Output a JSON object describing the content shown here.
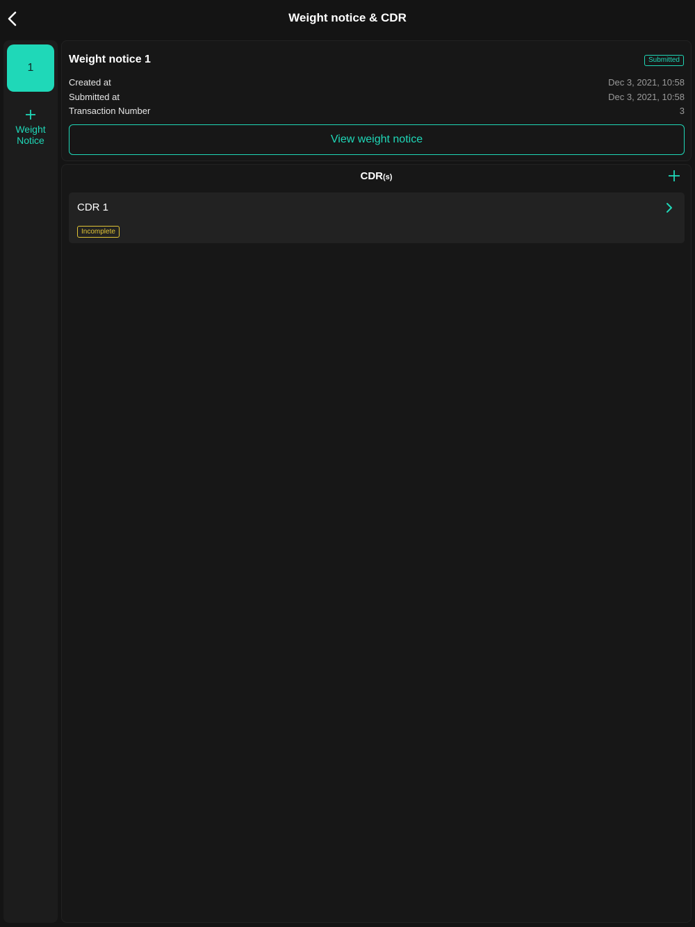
{
  "header": {
    "title": "Weight notice & CDR",
    "back_icon": "chevron-left-icon"
  },
  "rail": {
    "notices": [
      {
        "label": "1",
        "selected": true
      }
    ],
    "add_label_line1": "Weight",
    "add_label_line2": "Notice",
    "add_icon": "plus-icon"
  },
  "notice": {
    "title": "Weight notice 1",
    "status": "Submitted",
    "rows": [
      {
        "label": "Created at",
        "value": "Dec 3, 2021, 10:58"
      },
      {
        "label": "Submitted at",
        "value": "Dec 3, 2021, 10:58"
      },
      {
        "label": "Transaction Number",
        "value": "3"
      }
    ],
    "view_button": "View weight notice"
  },
  "cdr": {
    "heading": "CDR",
    "heading_suffix": "(s)",
    "add_icon": "plus-icon",
    "items": [
      {
        "name": "CDR 1",
        "status": "Incomplete",
        "chevron_icon": "chevron-right-icon"
      }
    ]
  },
  "colors": {
    "background": "#141414",
    "accent": "#1fd8b8",
    "warning": "#e2c535",
    "card": "#171717",
    "item": "#222222"
  }
}
